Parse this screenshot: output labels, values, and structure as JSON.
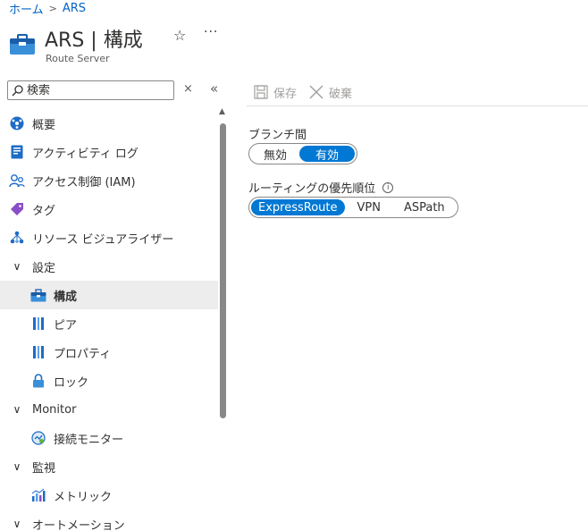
{
  "breadcrumb": {
    "home": "ホーム",
    "current": "ARS"
  },
  "header": {
    "title": "ARS | 構成",
    "subtitle": "Route Server",
    "star_icon": "☆",
    "more_icon": "···"
  },
  "sidebar": {
    "search_placeholder": "検索",
    "clear_icon": "×",
    "collapse_icon": "«",
    "items": [
      {
        "label": "概要",
        "icon": "overview-icon"
      },
      {
        "label": "アクティビティ ログ",
        "icon": "activity-log-icon"
      },
      {
        "label": "アクセス制御 (IAM)",
        "icon": "iam-icon"
      },
      {
        "label": "タグ",
        "icon": "tag-icon"
      },
      {
        "label": "リソース ビジュアライザー",
        "icon": "visualizer-icon"
      },
      {
        "label": "設定",
        "icon": "chevron-down-icon"
      },
      {
        "label": "構成",
        "icon": "configuration-icon"
      },
      {
        "label": "ピア",
        "icon": "peer-icon"
      },
      {
        "label": "プロパティ",
        "icon": "properties-icon"
      },
      {
        "label": "ロック",
        "icon": "lock-icon"
      },
      {
        "label": "Monitor",
        "icon": "chevron-down-icon"
      },
      {
        "label": "接続モニター",
        "icon": "connection-monitor-icon"
      },
      {
        "label": "監視",
        "icon": "chevron-down-icon"
      },
      {
        "label": "メトリック",
        "icon": "metrics-icon"
      },
      {
        "label": "オートメーション",
        "icon": "chevron-down-icon"
      }
    ]
  },
  "toolbar": {
    "save_label": "保存",
    "discard_label": "破棄"
  },
  "form": {
    "branch": {
      "label": "ブランチ間",
      "options": [
        "無効",
        "有効"
      ],
      "selected": "有効"
    },
    "routing": {
      "label": "ルーティングの優先順位",
      "info_icon": "i",
      "options": [
        "ExpressRoute",
        "VPN",
        "ASPath"
      ],
      "selected": "ExpressRoute"
    }
  },
  "colors": {
    "accent": "#0078d4",
    "link": "#0064c8",
    "selected_bg": "#ededed"
  }
}
